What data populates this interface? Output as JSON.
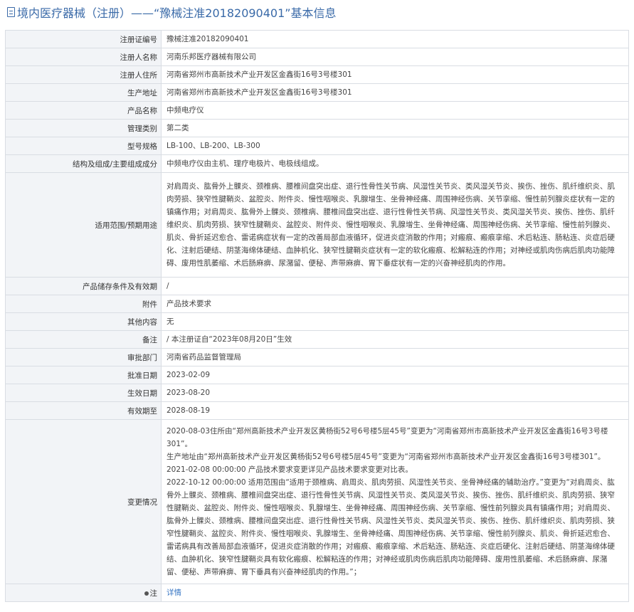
{
  "header": {
    "icon": "document-icon",
    "title": "境内医疗器械（注册）——“豫械注准20182090401”基本信息"
  },
  "rows": {
    "reg_no": {
      "label": "注册证编号",
      "value": "豫械注准20182090401"
    },
    "registrant": {
      "label": "注册人名称",
      "value": "河南乐邦医疗器械有限公司"
    },
    "registrant_addr": {
      "label": "注册人住所",
      "value": "河南省郑州市高新技术产业开发区金鑫街16号3号楼301"
    },
    "production_addr": {
      "label": "生产地址",
      "value": "河南省郑州市高新技术产业开发区金鑫街16号3号楼301"
    },
    "product_name": {
      "label": "产品名称",
      "value": "中频电疗仪"
    },
    "category": {
      "label": "管理类别",
      "value": "第二类"
    },
    "model": {
      "label": "型号规格",
      "value": "LB-100、LB-200、LB-300"
    },
    "structure": {
      "label": "结构及组成/主要组成成分",
      "value": "中频电疗仪由主机、理疗电极片、电极线组成。"
    },
    "scope": {
      "label": "适用范围/预期用途",
      "value": "对肩周炎、肱骨外上髁炎、颈椎病、腰椎间盘突出症、退行性骨性关节病、风湿性关节炎、类风湿关节炎、挨伤、挫伤、肌纤维织炎、肌肉劳损、狭窄性腱鞘炎、盆腔炎、附件炎、慢性咽喉炎、乳腺增生、坐骨神经痛、周围神经伤病、关节挛缩、慢性前列腺炎症状有一定的镇痛作用；对肩周炎、肱骨外上髁炎、颈椎病、腰椎间盘突出症、退行性骨性关节病、风湿性关节炎、类风湿关节炎、挨伤、挫伤、肌纤维织炎、肌肉劳损、狭窄性腱鞘炎、盆腔炎、附件炎、慢性咽喉炎、乳腺增生、坐骨神经痛、周围神经伤病、关节挛缩、慢性前列腺炎、肌炎、骨折延迟愈合、雷诺病症状有一定的改善局部血液循环，促进炎症消散的作用；对瘢痕、瘢痕挛缩、术后粘连、肠粘连、炎症后硬化、注射后硬结、阴茎海绵体硬结、血肿机化、狭窄性腱鞘炎症状有一定的软化瘢痕、松解粘连的作用；对神经或肌肉伤病后肌肉功能障碍、废用性肌萎缩、术后肠麻痹、尿潴留、便秘、声带麻痹、胃下垂症状有一定的兴奋神经肌肉的作用。"
    },
    "storage": {
      "label": "产品储存条件及有效期",
      "value": "/"
    },
    "attachment": {
      "label": "附件",
      "value": "产品技术要求"
    },
    "other": {
      "label": "其他内容",
      "value": "无"
    },
    "remark": {
      "label": "备注",
      "value": "/ 本注册证自“2023年08月20日”生效"
    },
    "authority": {
      "label": "审批部门",
      "value": "河南省药品监督管理局"
    },
    "approval_date": {
      "label": "批准日期",
      "value": "2023-02-09"
    },
    "effective_date": {
      "label": "生效日期",
      "value": "2023-08-20"
    },
    "expiry": {
      "label": "有效期至",
      "value": "2028-08-19"
    },
    "changes": {
      "label": "变更情况",
      "lines": [
        "2020-08-03住所由“郑州高新技术产业开发区黄杨街52号6号楼5层45号”变更为“河南省郑州市高新技术产业开发区金鑫街16号3号楼301”。",
        "生产地址由“郑州高新技术产业开发区黄杨街52号6号楼5层45号”变更为“河南省郑州市高新技术产业开发区金鑫街16号3号楼301”。",
        "2021-02-08 00:00:00 产品技术要求变更详见产品技术要求变更对比表。",
        "2022-10-12 00:00:00 适用范围由“适用于颈椎病、肩周炎、肌肉劳损、风湿性关节炎、坐骨神经痛的辅助治疗。”变更为“对肩周炎、肱骨外上髁炎、颈椎病、腰椎间盘突出症、退行性骨性关节病、风湿性关节炎、类风湿关节炎、挨伤、挫伤、肌纤维织炎、肌肉劳损、狭窄性腱鞘炎、盆腔炎、附件炎、慢性咽喉炎、乳腺增生、坐骨神经痛、周围神经伤病、关节挛缩、慢性前列腺炎具有镇痛作用；对肩周炎、肱骨外上髁炎、颈椎病、腰椎间盘突出症、退行性骨性关节病、风湿性关节炎、类风湿关节炎、挨伤、挫伤、肌纤维织炎、肌肉劳损、狭窄性腱鞘炎、盆腔炎、附件炎、慢性咽喉炎、乳腺增生、坐骨神经痛、周围神经伤病、关节挛缩、慢性前列腺炎、肌炎、骨折延迟愈合、雷诺病具有改善局部血液循环，促进炎症消散的作用；对瘢痕、瘢痕挛缩、术后粘连、肠粘连、炎症后硬化、注射后硬结、阴茎海绵体硬结、血肿机化、狭窄性腱鞘炎具有软化瘢痕、松解粘连的作用；对神经或肌肉伤病后肌肉功能障碍、废用性肌萎缩、术后肠麻痹、尿潴留、便秘、声带麻痹、胃下垂具有兴奋神经肌肉的作用。”；"
      ]
    },
    "note": {
      "label": "注",
      "icon": "pin-icon",
      "value": "详情"
    }
  },
  "colors": {
    "header": "#3a6aa8",
    "label_bg": "#f2f4f7",
    "border": "#d9dde3",
    "link": "#3a78c5"
  }
}
